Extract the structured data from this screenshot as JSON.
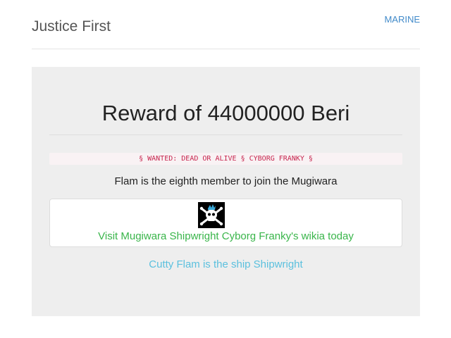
{
  "header": {
    "brand": "Justice First",
    "nav_link": "MARINE"
  },
  "bounty": {
    "title": "Reward of 44000000 Beri",
    "wanted_notice": "§ WANTED: DEAD OR ALIVE § CYBORG FRANKY §",
    "description": "Flam is the eighth member to join the Mugiwara",
    "wikia_link": "Visit Mugiwara Shipwright Cyborg Franky's wikia today",
    "shipwright_link": "Cutty Flam is the ship Shipwright"
  },
  "icons": {
    "flag": "jolly-roger-icon"
  },
  "colors": {
    "brand_text": "#555555",
    "nav_link": "#428bca",
    "jumbotron_bg": "#eeeeee",
    "wanted_text": "#c7254e",
    "wanted_bg": "#f9f2f4",
    "wikia_link": "#39b54a",
    "shipwright_link": "#5bc0de"
  }
}
